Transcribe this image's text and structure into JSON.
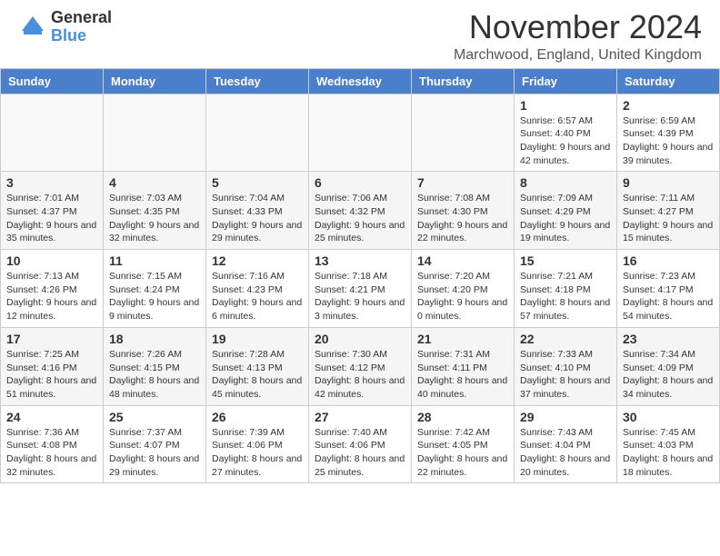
{
  "header": {
    "logo_general": "General",
    "logo_blue": "Blue",
    "month_title": "November 2024",
    "location": "Marchwood, England, United Kingdom"
  },
  "days_of_week": [
    "Sunday",
    "Monday",
    "Tuesday",
    "Wednesday",
    "Thursday",
    "Friday",
    "Saturday"
  ],
  "weeks": [
    [
      {
        "day": "",
        "info": ""
      },
      {
        "day": "",
        "info": ""
      },
      {
        "day": "",
        "info": ""
      },
      {
        "day": "",
        "info": ""
      },
      {
        "day": "",
        "info": ""
      },
      {
        "day": "1",
        "info": "Sunrise: 6:57 AM\nSunset: 4:40 PM\nDaylight: 9 hours and 42 minutes."
      },
      {
        "day": "2",
        "info": "Sunrise: 6:59 AM\nSunset: 4:39 PM\nDaylight: 9 hours and 39 minutes."
      }
    ],
    [
      {
        "day": "3",
        "info": "Sunrise: 7:01 AM\nSunset: 4:37 PM\nDaylight: 9 hours and 35 minutes."
      },
      {
        "day": "4",
        "info": "Sunrise: 7:03 AM\nSunset: 4:35 PM\nDaylight: 9 hours and 32 minutes."
      },
      {
        "day": "5",
        "info": "Sunrise: 7:04 AM\nSunset: 4:33 PM\nDaylight: 9 hours and 29 minutes."
      },
      {
        "day": "6",
        "info": "Sunrise: 7:06 AM\nSunset: 4:32 PM\nDaylight: 9 hours and 25 minutes."
      },
      {
        "day": "7",
        "info": "Sunrise: 7:08 AM\nSunset: 4:30 PM\nDaylight: 9 hours and 22 minutes."
      },
      {
        "day": "8",
        "info": "Sunrise: 7:09 AM\nSunset: 4:29 PM\nDaylight: 9 hours and 19 minutes."
      },
      {
        "day": "9",
        "info": "Sunrise: 7:11 AM\nSunset: 4:27 PM\nDaylight: 9 hours and 15 minutes."
      }
    ],
    [
      {
        "day": "10",
        "info": "Sunrise: 7:13 AM\nSunset: 4:26 PM\nDaylight: 9 hours and 12 minutes."
      },
      {
        "day": "11",
        "info": "Sunrise: 7:15 AM\nSunset: 4:24 PM\nDaylight: 9 hours and 9 minutes."
      },
      {
        "day": "12",
        "info": "Sunrise: 7:16 AM\nSunset: 4:23 PM\nDaylight: 9 hours and 6 minutes."
      },
      {
        "day": "13",
        "info": "Sunrise: 7:18 AM\nSunset: 4:21 PM\nDaylight: 9 hours and 3 minutes."
      },
      {
        "day": "14",
        "info": "Sunrise: 7:20 AM\nSunset: 4:20 PM\nDaylight: 9 hours and 0 minutes."
      },
      {
        "day": "15",
        "info": "Sunrise: 7:21 AM\nSunset: 4:18 PM\nDaylight: 8 hours and 57 minutes."
      },
      {
        "day": "16",
        "info": "Sunrise: 7:23 AM\nSunset: 4:17 PM\nDaylight: 8 hours and 54 minutes."
      }
    ],
    [
      {
        "day": "17",
        "info": "Sunrise: 7:25 AM\nSunset: 4:16 PM\nDaylight: 8 hours and 51 minutes."
      },
      {
        "day": "18",
        "info": "Sunrise: 7:26 AM\nSunset: 4:15 PM\nDaylight: 8 hours and 48 minutes."
      },
      {
        "day": "19",
        "info": "Sunrise: 7:28 AM\nSunset: 4:13 PM\nDaylight: 8 hours and 45 minutes."
      },
      {
        "day": "20",
        "info": "Sunrise: 7:30 AM\nSunset: 4:12 PM\nDaylight: 8 hours and 42 minutes."
      },
      {
        "day": "21",
        "info": "Sunrise: 7:31 AM\nSunset: 4:11 PM\nDaylight: 8 hours and 40 minutes."
      },
      {
        "day": "22",
        "info": "Sunrise: 7:33 AM\nSunset: 4:10 PM\nDaylight: 8 hours and 37 minutes."
      },
      {
        "day": "23",
        "info": "Sunrise: 7:34 AM\nSunset: 4:09 PM\nDaylight: 8 hours and 34 minutes."
      }
    ],
    [
      {
        "day": "24",
        "info": "Sunrise: 7:36 AM\nSunset: 4:08 PM\nDaylight: 8 hours and 32 minutes."
      },
      {
        "day": "25",
        "info": "Sunrise: 7:37 AM\nSunset: 4:07 PM\nDaylight: 8 hours and 29 minutes."
      },
      {
        "day": "26",
        "info": "Sunrise: 7:39 AM\nSunset: 4:06 PM\nDaylight: 8 hours and 27 minutes."
      },
      {
        "day": "27",
        "info": "Sunrise: 7:40 AM\nSunset: 4:06 PM\nDaylight: 8 hours and 25 minutes."
      },
      {
        "day": "28",
        "info": "Sunrise: 7:42 AM\nSunset: 4:05 PM\nDaylight: 8 hours and 22 minutes."
      },
      {
        "day": "29",
        "info": "Sunrise: 7:43 AM\nSunset: 4:04 PM\nDaylight: 8 hours and 20 minutes."
      },
      {
        "day": "30",
        "info": "Sunrise: 7:45 AM\nSunset: 4:03 PM\nDaylight: 8 hours and 18 minutes."
      }
    ]
  ]
}
